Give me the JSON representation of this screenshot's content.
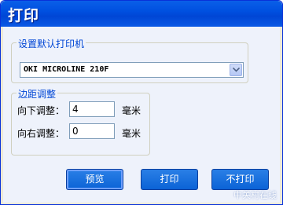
{
  "window": {
    "title": "打印"
  },
  "printer_group": {
    "label": "设置默认打印机",
    "selected_printer": "OKI MICROLINE 210F"
  },
  "margin_group": {
    "label": "边距调整",
    "down_label": "向下调整：",
    "down_value": "4",
    "right_label": "向右调整：",
    "right_value": "0",
    "unit": "毫米"
  },
  "buttons": {
    "preview": "预览",
    "print": "打印",
    "no_print": "不打印"
  },
  "watermark": "中关村在线"
}
